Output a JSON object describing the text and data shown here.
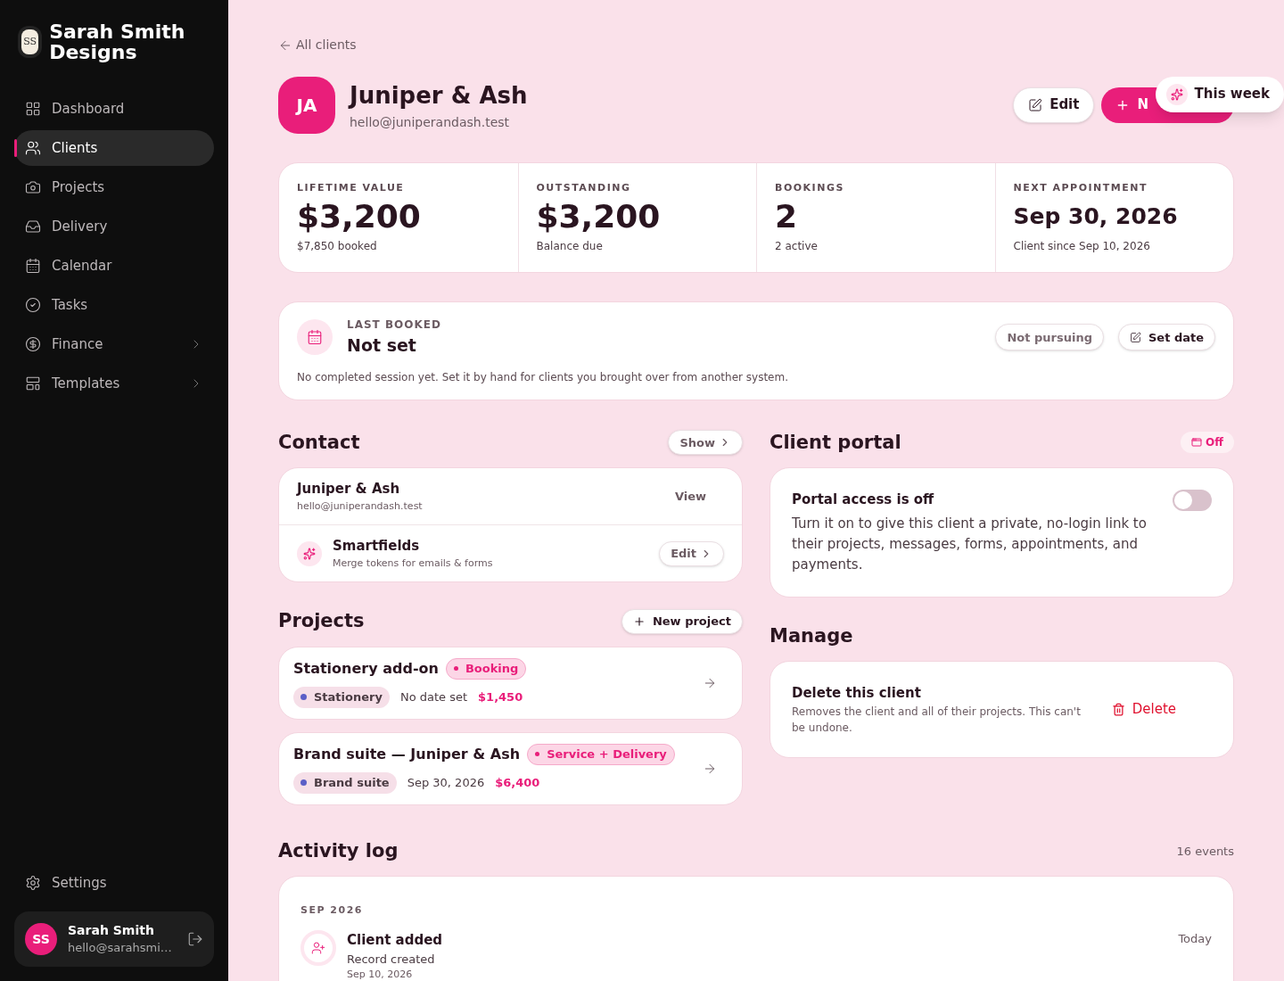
{
  "brand": {
    "initials": "SS",
    "name": "Sarah Smith Designs"
  },
  "nav": [
    {
      "label": "Dashboard",
      "selected": false,
      "expandable": false
    },
    {
      "label": "Clients",
      "selected": true,
      "expandable": false
    },
    {
      "label": "Projects",
      "selected": false,
      "expandable": false
    },
    {
      "label": "Delivery",
      "selected": false,
      "expandable": false
    },
    {
      "label": "Calendar",
      "selected": false,
      "expandable": false
    },
    {
      "label": "Tasks",
      "selected": false,
      "expandable": false
    },
    {
      "label": "Finance",
      "selected": false,
      "expandable": true
    },
    {
      "label": "Templates",
      "selected": false,
      "expandable": true
    }
  ],
  "settings": "Settings",
  "user": {
    "initials": "SS",
    "name": "Sarah Smith",
    "email": "hello@sarahsmi…"
  },
  "back_link": "All clients",
  "client": {
    "initials": "JA",
    "name": "Juniper & Ash",
    "email": "hello@juniperandash.test"
  },
  "actions": {
    "edit": "Edit",
    "primary": "N"
  },
  "popover": "This week",
  "stats": [
    {
      "label": "LIFETIME VALUE",
      "value": "$3,200",
      "note": "$7,850 booked",
      "kind": "amount"
    },
    {
      "label": "OUTSTANDING",
      "value": "$3,200",
      "note": "Balance due",
      "kind": "amount"
    },
    {
      "label": "BOOKINGS",
      "value": "2",
      "note": "2 active",
      "kind": "amount"
    },
    {
      "label": "NEXT APPOINTMENT",
      "value": "Sep 30, 2026",
      "note": "Client since Sep 10, 2026",
      "kind": "date"
    }
  ],
  "last_booked": {
    "label": "LAST BOOKED",
    "value": "Not set",
    "note": "No completed session yet. Set it by hand for clients you brought over from another system.",
    "secondary": "Not pursuing",
    "primary": "Set date"
  },
  "contact": {
    "title": "Contact",
    "toggle": "Show",
    "name": "Juniper & Ash",
    "email": "hello@juniperandash.test",
    "action": "View",
    "smart_title": "Smartfields",
    "smart_note": "Merge tokens for emails & forms",
    "smart_action": "Edit"
  },
  "portal": {
    "title": "Client portal",
    "badge": "Off",
    "heading": "Portal access is off",
    "text": "Turn it on to give this client a private, no-login link to their projects, messages, forms, appointments, and payments.",
    "on": false
  },
  "projects": {
    "title": "Projects",
    "action": "New project",
    "items": [
      {
        "name": "Stationery add-on",
        "status": "Booking",
        "category": "Stationery",
        "color": "#5b5fc7",
        "date": "No date set",
        "amount": "$1,450"
      },
      {
        "name": "Brand suite — Juniper & Ash",
        "status": "Service + Delivery",
        "category": "Brand suite",
        "color": "#5b5fc7",
        "date": "Sep 30, 2026",
        "amount": "$6,400"
      }
    ]
  },
  "manage": {
    "title": "Manage",
    "heading": "Delete this client",
    "text": "Removes the client and all of their projects. This can't be undone.",
    "action": "Delete"
  },
  "activity": {
    "title": "Activity log",
    "count": "16 events",
    "month": "SEP 2026",
    "events": [
      {
        "title": "Client added",
        "note": "Record created",
        "date": "Sep 10, 2026",
        "time": "Today"
      }
    ]
  }
}
